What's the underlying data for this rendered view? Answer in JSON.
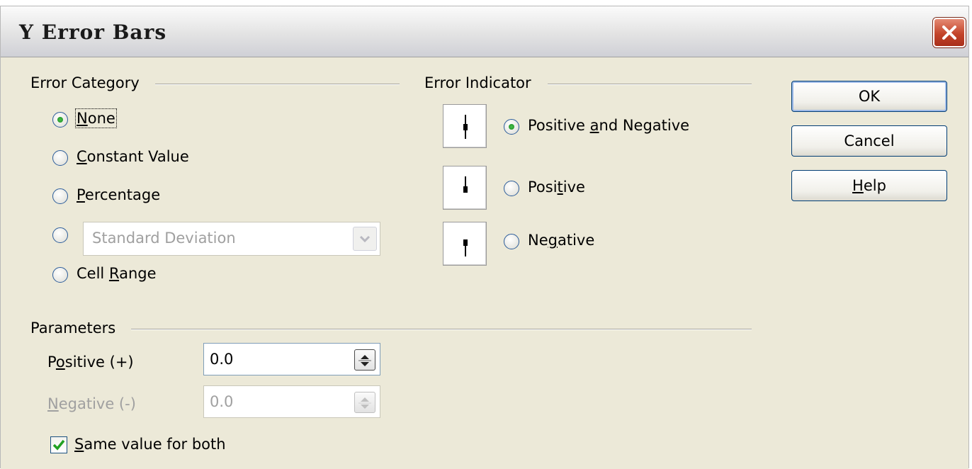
{
  "dialog": {
    "title": "Y Error Bars"
  },
  "error_category": {
    "legend": "Error Category",
    "options": [
      {
        "pre": "",
        "key": "N",
        "post": "one",
        "selected": true
      },
      {
        "pre": "",
        "key": "C",
        "post": "onstant Value",
        "selected": false
      },
      {
        "pre": "",
        "key": "P",
        "post": "ercentage",
        "selected": false
      },
      {
        "pre": "",
        "key": "",
        "post": "",
        "selected": false
      },
      {
        "pre": "Cell ",
        "key": "R",
        "post": "ange",
        "selected": false
      }
    ],
    "function_dropdown": {
      "value": "Standard Deviation",
      "enabled": false
    }
  },
  "error_indicator": {
    "legend": "Error Indicator",
    "options": [
      {
        "pre": "Positive ",
        "key": "a",
        "post": "nd Negative",
        "selected": true,
        "icon": "both-error-bar-icon"
      },
      {
        "pre": "Posi",
        "key": "t",
        "post": "ive",
        "selected": false,
        "icon": "positive-error-bar-icon"
      },
      {
        "pre": "Ne",
        "key": "g",
        "post": "ative",
        "selected": false,
        "icon": "negative-error-bar-icon"
      }
    ]
  },
  "buttons": {
    "ok": "OK",
    "cancel": "Cancel",
    "help_key": "H",
    "help_rest": "elp"
  },
  "parameters": {
    "legend": "Parameters",
    "positive": {
      "pre": "P",
      "key": "o",
      "post": "sitive (+)",
      "value": "0.0",
      "enabled": true
    },
    "negative": {
      "pre": "",
      "key": "N",
      "post": "egative (-)",
      "value": "0.0",
      "enabled": false
    },
    "same_value": {
      "pre": "",
      "key": "S",
      "post": "ame value for both",
      "checked": true
    }
  },
  "colors": {
    "radio_selected": "#2f9e33",
    "checkbox_tick": "#21a121",
    "close_button": "#c3442a"
  }
}
